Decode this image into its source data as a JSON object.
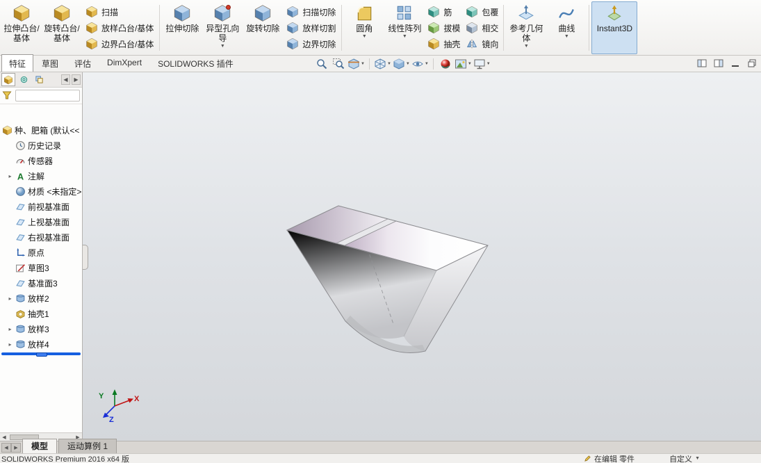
{
  "colors": {
    "accent": "#2a6fc4",
    "rollback_bar": "#155fe0",
    "instant3d_active_bg": "#cde0f2",
    "triad_x": "#c01414",
    "triad_y": "#0a7a22",
    "triad_z": "#1a2fd6"
  },
  "ribbon": {
    "groups": [
      {
        "label": "拉伸凸台/基体"
      },
      {
        "label": "旋转凸台/基体"
      },
      {
        "items": [
          {
            "label": "扫描"
          },
          {
            "label": "放样凸台/基体"
          },
          {
            "label": "边界凸台/基体"
          }
        ]
      },
      {
        "sep": true
      },
      {
        "label": "拉伸切除"
      },
      {
        "label": "异型孔向导"
      },
      {
        "label": "旋转切除"
      },
      {
        "items": [
          {
            "label": "扫描切除"
          },
          {
            "label": "放样切割"
          },
          {
            "label": "边界切除"
          }
        ]
      },
      {
        "sep": true
      },
      {
        "label": "圆角"
      },
      {
        "label": "线性阵列"
      },
      {
        "items": [
          {
            "label": "筋"
          },
          {
            "label": "拔模"
          },
          {
            "label": "抽壳"
          }
        ]
      },
      {
        "items": [
          {
            "label": "包覆"
          },
          {
            "label": "相交"
          },
          {
            "label": "镜向"
          }
        ]
      },
      {
        "sep": true
      },
      {
        "label": "参考几何体"
      },
      {
        "label": "曲线"
      },
      {
        "sep": true
      },
      {
        "label": "Instant3D"
      }
    ]
  },
  "tabs": {
    "items": [
      {
        "label": "特征",
        "active": true
      },
      {
        "label": "草图"
      },
      {
        "label": "评估"
      },
      {
        "label": "DimXpert"
      },
      {
        "label": "SOLIDWORKS 插件"
      }
    ]
  },
  "hud": {
    "buttons": [
      "zoom-to-fit",
      "zoom-to-area",
      "section-view",
      "view-orientation",
      "display-style",
      "hide-show-items",
      "edit-appearance",
      "apply-scene",
      "view-settings"
    ]
  },
  "filter": {
    "value": ""
  },
  "tree": {
    "items": [
      {
        "label": "种、肥箱 (默认<<",
        "icon": "part",
        "expander": false
      },
      {
        "label": "历史记录",
        "icon": "history",
        "expander": false
      },
      {
        "label": "传感器",
        "icon": "sensors",
        "expander": false
      },
      {
        "label": "注解",
        "icon": "annotations",
        "expander": true
      },
      {
        "label": "材质 <未指定>",
        "icon": "material",
        "expander": false
      },
      {
        "label": "前视基准面",
        "icon": "plane",
        "expander": false
      },
      {
        "label": "上视基准面",
        "icon": "plane",
        "expander": false
      },
      {
        "label": "右视基准面",
        "icon": "plane",
        "expander": false
      },
      {
        "label": "原点",
        "icon": "origin",
        "expander": false
      },
      {
        "label": "草图3",
        "icon": "sketch",
        "expander": false
      },
      {
        "label": "基准面3",
        "icon": "plane",
        "expander": false
      },
      {
        "label": "放样2",
        "icon": "loft",
        "expander": true
      },
      {
        "label": "抽壳1",
        "icon": "shell",
        "expander": false
      },
      {
        "label": "放样3",
        "icon": "loft",
        "expander": true
      },
      {
        "label": "放样4",
        "icon": "loft",
        "expander": true
      }
    ]
  },
  "viewport": {
    "triad": {
      "x": "X",
      "y": "Y",
      "z": "Z"
    }
  },
  "bottom_tabs": {
    "items": [
      {
        "label": "模型",
        "active": true
      },
      {
        "label": "运动算例 1"
      }
    ]
  },
  "status": {
    "left": "SOLIDWORKS Premium 2016 x64 版",
    "editing": "在编辑 零件",
    "custom": "自定义"
  }
}
